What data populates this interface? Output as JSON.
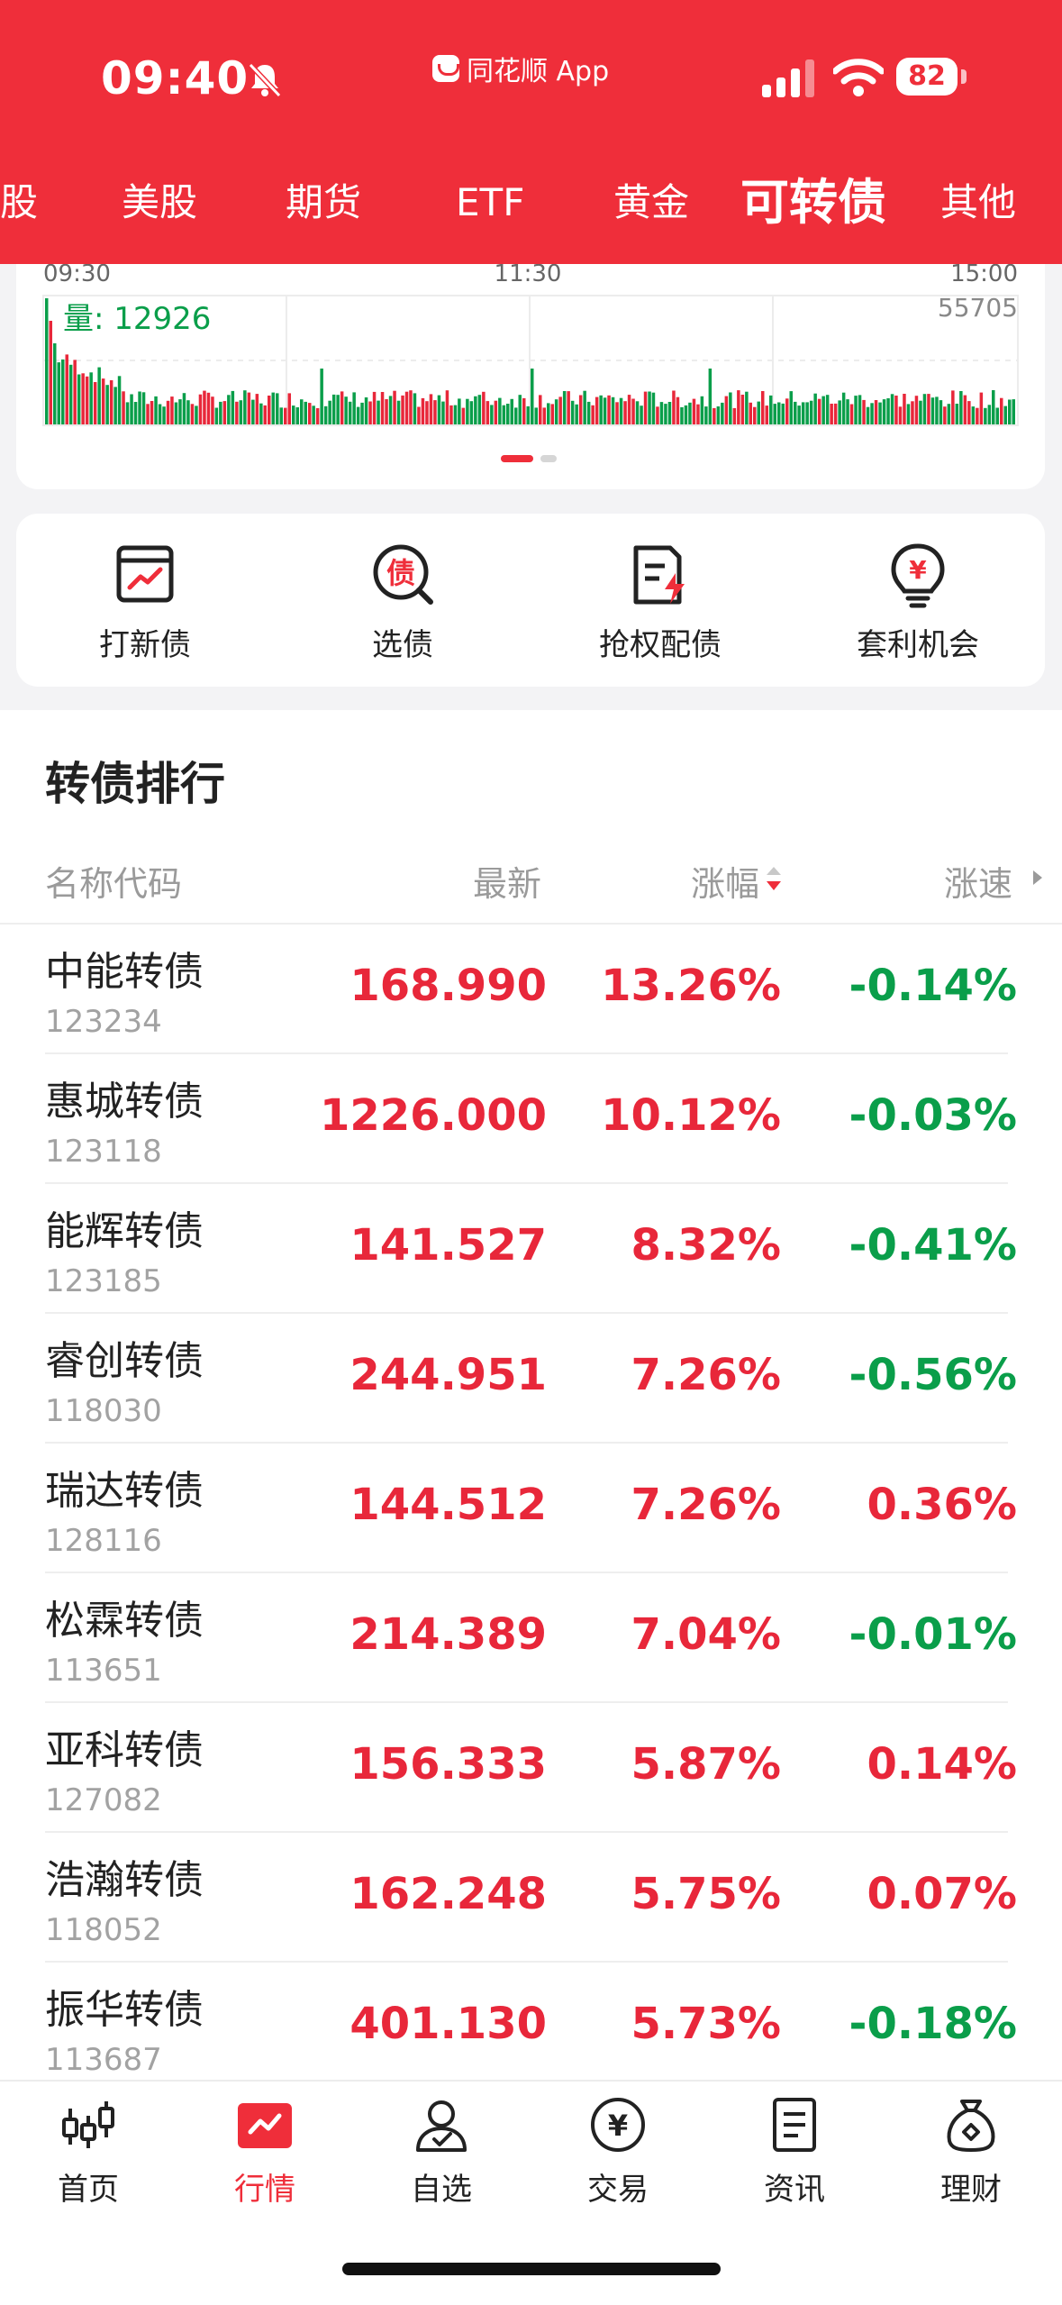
{
  "status_bar": {
    "time": "09:40",
    "app_name": "同花顺 App",
    "battery": "82"
  },
  "market_tabs": [
    {
      "label": "股"
    },
    {
      "label": "美股"
    },
    {
      "label": "期货"
    },
    {
      "label": "ETF"
    },
    {
      "label": "黄金"
    },
    {
      "label": "可转债",
      "active": true
    },
    {
      "label": "其他"
    }
  ],
  "volume_chart": {
    "time_start": "09:30",
    "time_mid": "11:30",
    "time_end": "15:00",
    "volume_label": "量: 12926",
    "max_label": "55705"
  },
  "shortcuts": [
    {
      "label": "打新债",
      "icon": "new-bond-icon"
    },
    {
      "label": "选债",
      "icon": "select-bond-icon"
    },
    {
      "label": "抢权配债",
      "icon": "rights-bond-icon"
    },
    {
      "label": "套利机会",
      "icon": "arbitrage-icon"
    }
  ],
  "ranking": {
    "title": "转债排行",
    "headers": {
      "name": "名称代码",
      "latest": "最新",
      "change": "涨幅",
      "speed": "涨速"
    },
    "rows": [
      {
        "name": "中能转债",
        "code": "123234",
        "price": "168.990",
        "change": "13.26%",
        "speed": "-0.14%",
        "speed_dir": "down"
      },
      {
        "name": "惠城转债",
        "code": "123118",
        "price": "1226.000",
        "change": "10.12%",
        "speed": "-0.03%",
        "speed_dir": "down"
      },
      {
        "name": "能辉转债",
        "code": "123185",
        "price": "141.527",
        "change": "8.32%",
        "speed": "-0.41%",
        "speed_dir": "down"
      },
      {
        "name": "睿创转债",
        "code": "118030",
        "price": "244.951",
        "change": "7.26%",
        "speed": "-0.56%",
        "speed_dir": "down"
      },
      {
        "name": "瑞达转债",
        "code": "128116",
        "price": "144.512",
        "change": "7.26%",
        "speed": "0.36%",
        "speed_dir": "up"
      },
      {
        "name": "松霖转债",
        "code": "113651",
        "price": "214.389",
        "change": "7.04%",
        "speed": "-0.01%",
        "speed_dir": "down"
      },
      {
        "name": "亚科转债",
        "code": "127082",
        "price": "156.333",
        "change": "5.87%",
        "speed": "0.14%",
        "speed_dir": "up"
      },
      {
        "name": "浩瀚转债",
        "code": "118052",
        "price": "162.248",
        "change": "5.75%",
        "speed": "0.07%",
        "speed_dir": "up"
      },
      {
        "name": "振华转债",
        "code": "113687",
        "price": "401.130",
        "change": "5.73%",
        "speed": "-0.18%",
        "speed_dir": "down"
      }
    ]
  },
  "bottom_nav": [
    {
      "label": "首页",
      "icon": "candlestick-icon"
    },
    {
      "label": "行情",
      "icon": "market-chart-icon",
      "active": true
    },
    {
      "label": "自选",
      "icon": "watchlist-person-icon"
    },
    {
      "label": "交易",
      "icon": "yuan-coin-icon"
    },
    {
      "label": "资讯",
      "icon": "news-document-icon"
    },
    {
      "label": "理财",
      "icon": "money-bag-icon"
    }
  ],
  "colors": {
    "brand_red": "#ef2e3a",
    "up_red": "#e8273a",
    "down_green": "#0a9e4a"
  }
}
